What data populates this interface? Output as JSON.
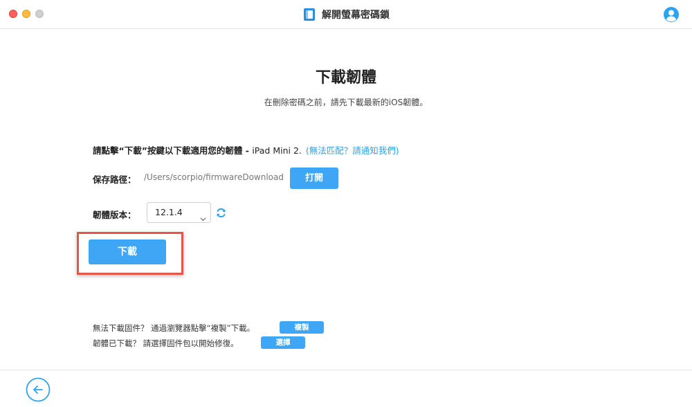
{
  "window": {
    "title": "解開螢幕密碼鎖"
  },
  "main": {
    "title": "下載韌體",
    "subtitle": "在刪除密碼之前，請先下載最新的iOS韌體。",
    "instruction": {
      "text": "請點擊“下載”按鍵以下載適用您的韌體 - ",
      "device": "iPad Mini 2.",
      "mismatch_link": "(無法匹配？請通知我們)"
    },
    "save_path": {
      "label": "保存路徑：",
      "value": "/Users/scorpio/firmwareDownload",
      "open_button": "打開"
    },
    "firmware_version": {
      "label": "韌體版本：",
      "selected": "12.1.4"
    },
    "download_button": "下載",
    "help": {
      "line1_text": "無法下載固件？ 通過瀏覽器點擊“複製”下載。",
      "copy_button": "複製",
      "line2_text": "韌體已下載？ 請選擇固件包以開始修復。",
      "select_button": "選擇"
    }
  },
  "colors": {
    "accent": "#3ea6f4",
    "link": "#2ba3f0",
    "highlight": "#e8534a"
  },
  "icons": {
    "app_logo": "book-icon",
    "account": "user-icon",
    "refresh": "refresh-icon",
    "back": "arrow-left-icon",
    "select_chevron": "chevron-down-icon"
  }
}
